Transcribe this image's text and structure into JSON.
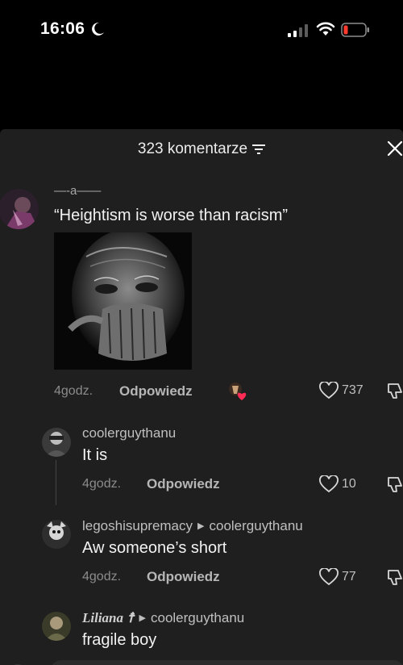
{
  "status_bar": {
    "time": "16:06",
    "icons": [
      "moon-icon",
      "cellular-signal-icon",
      "wifi-icon",
      "battery-low-icon"
    ],
    "battery_color": "#ff3b30"
  },
  "sheet": {
    "title": "323 komentarze",
    "background": "#1f1f1f"
  },
  "comments": [
    {
      "username": "—-a——",
      "text": "“Heightism is worse than racism”",
      "has_photo": true,
      "time": "4godz.",
      "reply_label": "Odpowiedz",
      "likes": "737"
    },
    {
      "username": "coolerguythanu",
      "text": "It is",
      "time": "4godz.",
      "reply_label": "Odpowiedz",
      "likes": "10"
    },
    {
      "username": "legoshisupremacy",
      "reply_to": "coolerguythanu",
      "text": "Aw someone’s short",
      "time": "4godz.",
      "reply_label": "Odpowiedz",
      "likes": "77"
    },
    {
      "username": "Liliana ☨",
      "reply_to": "coolerguythanu",
      "text": "fragile boy"
    }
  ]
}
